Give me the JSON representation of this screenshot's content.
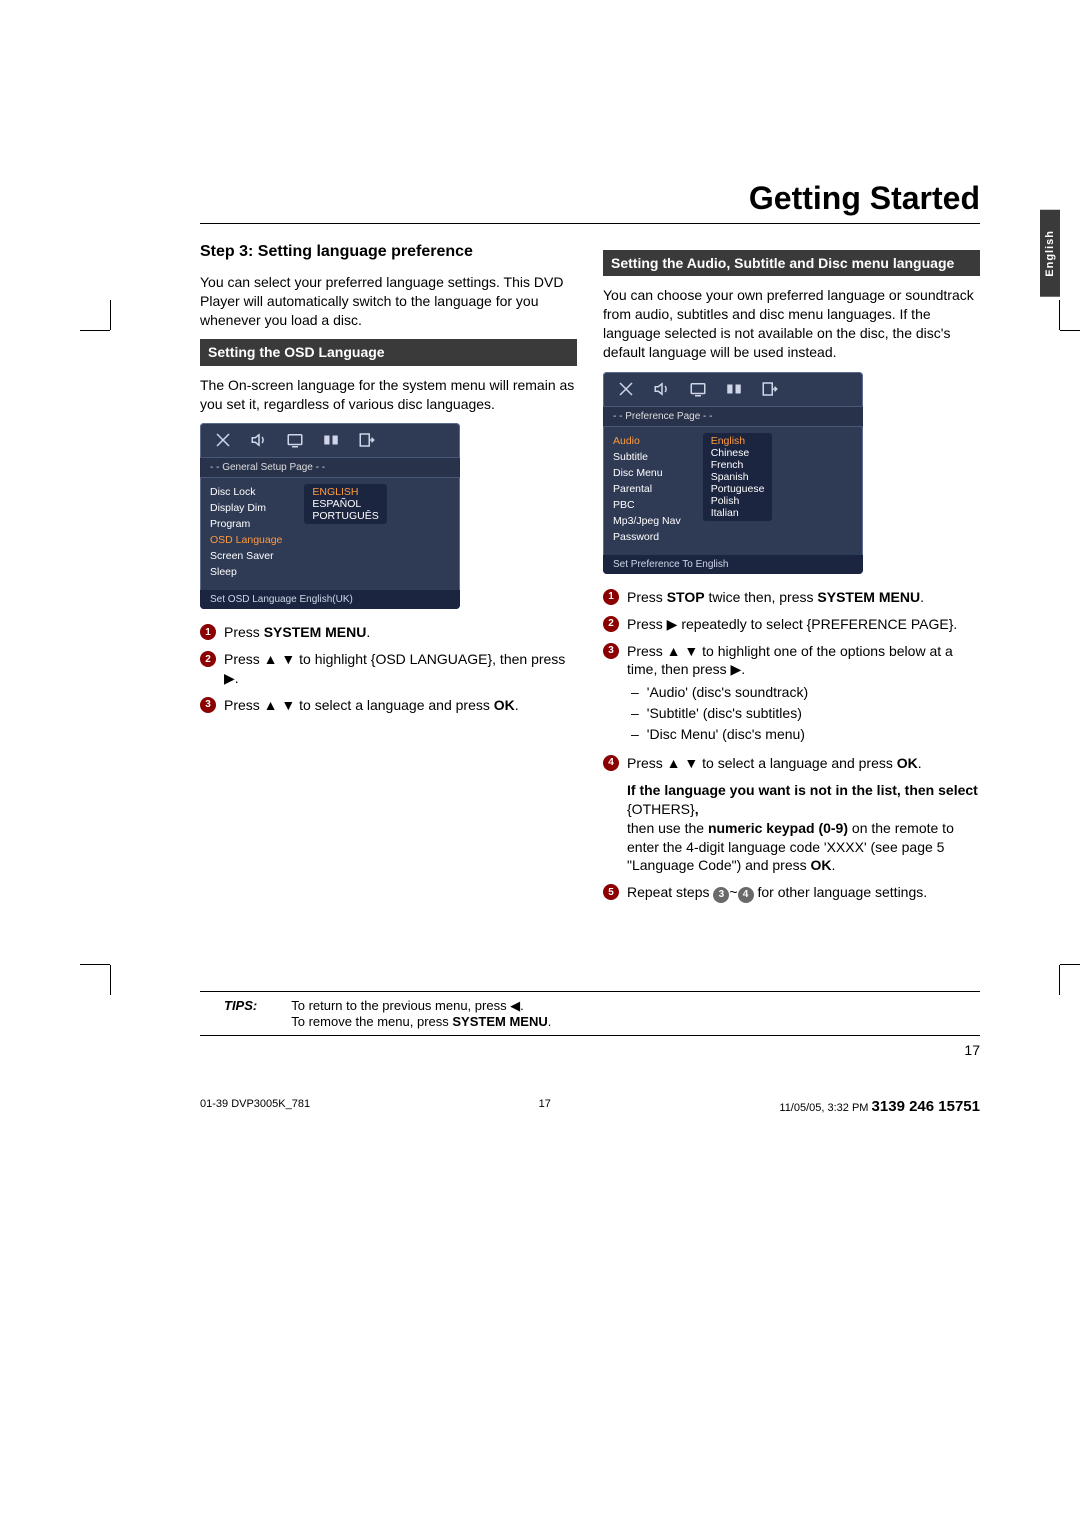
{
  "page_title": "Getting Started",
  "side_tab": "English",
  "left": {
    "step_title": "Step 3:  Setting language preference",
    "intro": "You can select your preferred language settings. This DVD Player will automatically switch to the language for you whenever you load a disc.",
    "subhead": "Setting the OSD Language",
    "para": "The On-screen language for the system menu will remain as you set it, regardless of various disc languages.",
    "osd": {
      "banner": "- -   General Setup Page   - -",
      "labels": [
        "Disc Lock",
        "Display Dim",
        "Program",
        "OSD Language",
        "Screen Saver",
        "Sleep"
      ],
      "values": [
        "ENGLISH",
        "ESPAÑOL",
        "PORTUGUÊS"
      ],
      "highlight_index": 3,
      "footer": "Set OSD Language English(UK)"
    },
    "steps": [
      {
        "n": "1",
        "html": "Press <b>SYSTEM MENU</b>."
      },
      {
        "n": "2",
        "html": "Press ▲ ▼ to highlight {OSD LANGUAGE}, then press ▶."
      },
      {
        "n": "3",
        "html": "Press ▲ ▼  to select a language and press <b>OK</b>."
      }
    ]
  },
  "right": {
    "subhead": "Setting the Audio, Subtitle and Disc menu language",
    "intro": "You can choose your own preferred language or soundtrack from audio, subtitles and disc menu languages. If the language selected is not available on the disc, the disc's default language will be used instead.",
    "osd": {
      "banner": "- -   Preference Page   - -",
      "labels": [
        "Audio",
        "Subtitle",
        "Disc Menu",
        "Parental",
        "PBC",
        "Mp3/Jpeg Nav",
        "Password"
      ],
      "values": [
        "English",
        "Chinese",
        "French",
        "Spanish",
        "Portuguese",
        "Polish",
        "Italian"
      ],
      "highlight_index": 0,
      "footer": "Set Preference To English"
    },
    "steps": [
      {
        "n": "1",
        "html": "Press <b>STOP</b> twice then, press <b>SYSTEM MENU</b>."
      },
      {
        "n": "2",
        "html": "Press ▶ repeatedly to select {PREFERENCE PAGE}."
      },
      {
        "n": "3",
        "html": "Press ▲ ▼  to highlight one of the options below at a time, then press ▶.",
        "subs": [
          "'Audio' (disc's soundtrack)",
          "'Subtitle' (disc's subtitles)",
          "'Disc Menu' (disc's menu)"
        ]
      },
      {
        "n": "4",
        "html": "Press ▲ ▼ to select a language and press <b>OK</b>.",
        "extra": "<b>If the language you want is not in the list, then select</b> {OTHERS}<b>,</b><br>then use the <b>numeric keypad (0-9)</b> on the remote to enter the 4-digit language code 'XXXX' (see page 5 \"Language Code\") and press <b>OK</b>."
      },
      {
        "n": "5",
        "html": "Repeat steps <span class='bullet grey'>3</span>~<span class='bullet grey'>4</span> for other language settings."
      }
    ]
  },
  "tips": {
    "label": "TIPS:",
    "line1": "To return to the previous menu, press ◀.",
    "line2_html": "To remove the menu, press <b>SYSTEM MENU</b>."
  },
  "page_number": "17",
  "footer": {
    "left": "01-39 DVP3005K_781",
    "mid": "17",
    "right_time": "11/05/05, 3:32 PM",
    "right_code": "3139 246 15751"
  }
}
